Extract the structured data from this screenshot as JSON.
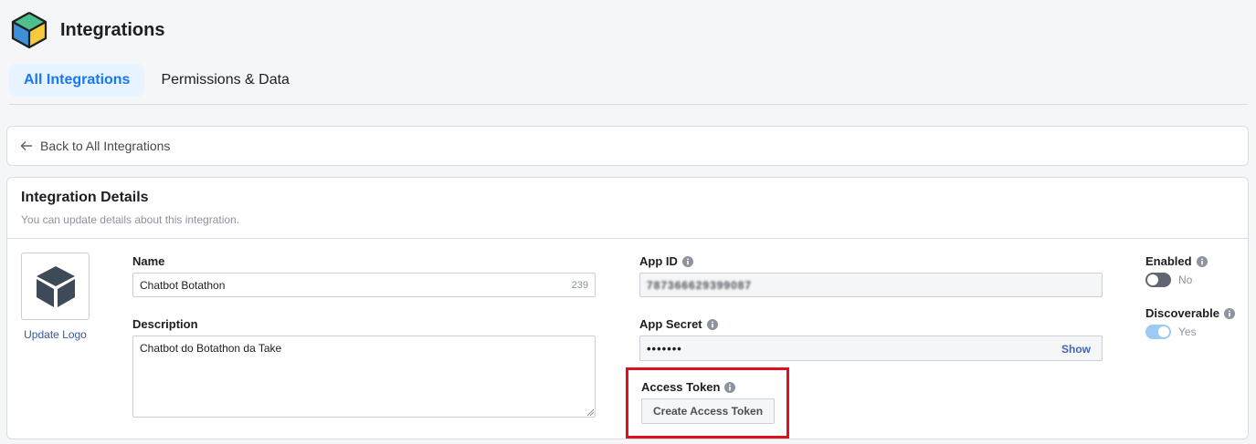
{
  "app": {
    "title": "Integrations",
    "logo_icon": "isometric-cube-icon"
  },
  "tabs": [
    {
      "label": "All Integrations",
      "active": true
    },
    {
      "label": "Permissions & Data",
      "active": false
    }
  ],
  "back_link": {
    "label": "Back to All Integrations",
    "icon": "arrow-left-icon"
  },
  "details": {
    "title": "Integration Details",
    "subtitle": "You can update details about this integration.",
    "update_logo_label": "Update Logo",
    "name_label": "Name",
    "name_value": "Chatbot Botathon",
    "name_remaining_chars": "239",
    "description_label": "Description",
    "description_value": "Chatbot do Botathon da Take",
    "app_id_label": "App ID",
    "app_id_value": "787366629399087",
    "app_secret_label": "App Secret",
    "app_secret_value": "•••••••",
    "app_secret_show_label": "Show",
    "access_token_label": "Access Token",
    "access_token_button": "Create Access Token",
    "enabled_label": "Enabled",
    "enabled_state": "No",
    "enabled": false,
    "discoverable_label": "Discoverable",
    "discoverable_state": "Yes",
    "discoverable": true
  },
  "colors": {
    "accent": "#1877f2",
    "tab_active_bg": "#e7f3ff",
    "link": "#385898",
    "highlight": "#e0101e",
    "toggle_off": "#606770",
    "toggle_on": "#9ecbf4"
  }
}
